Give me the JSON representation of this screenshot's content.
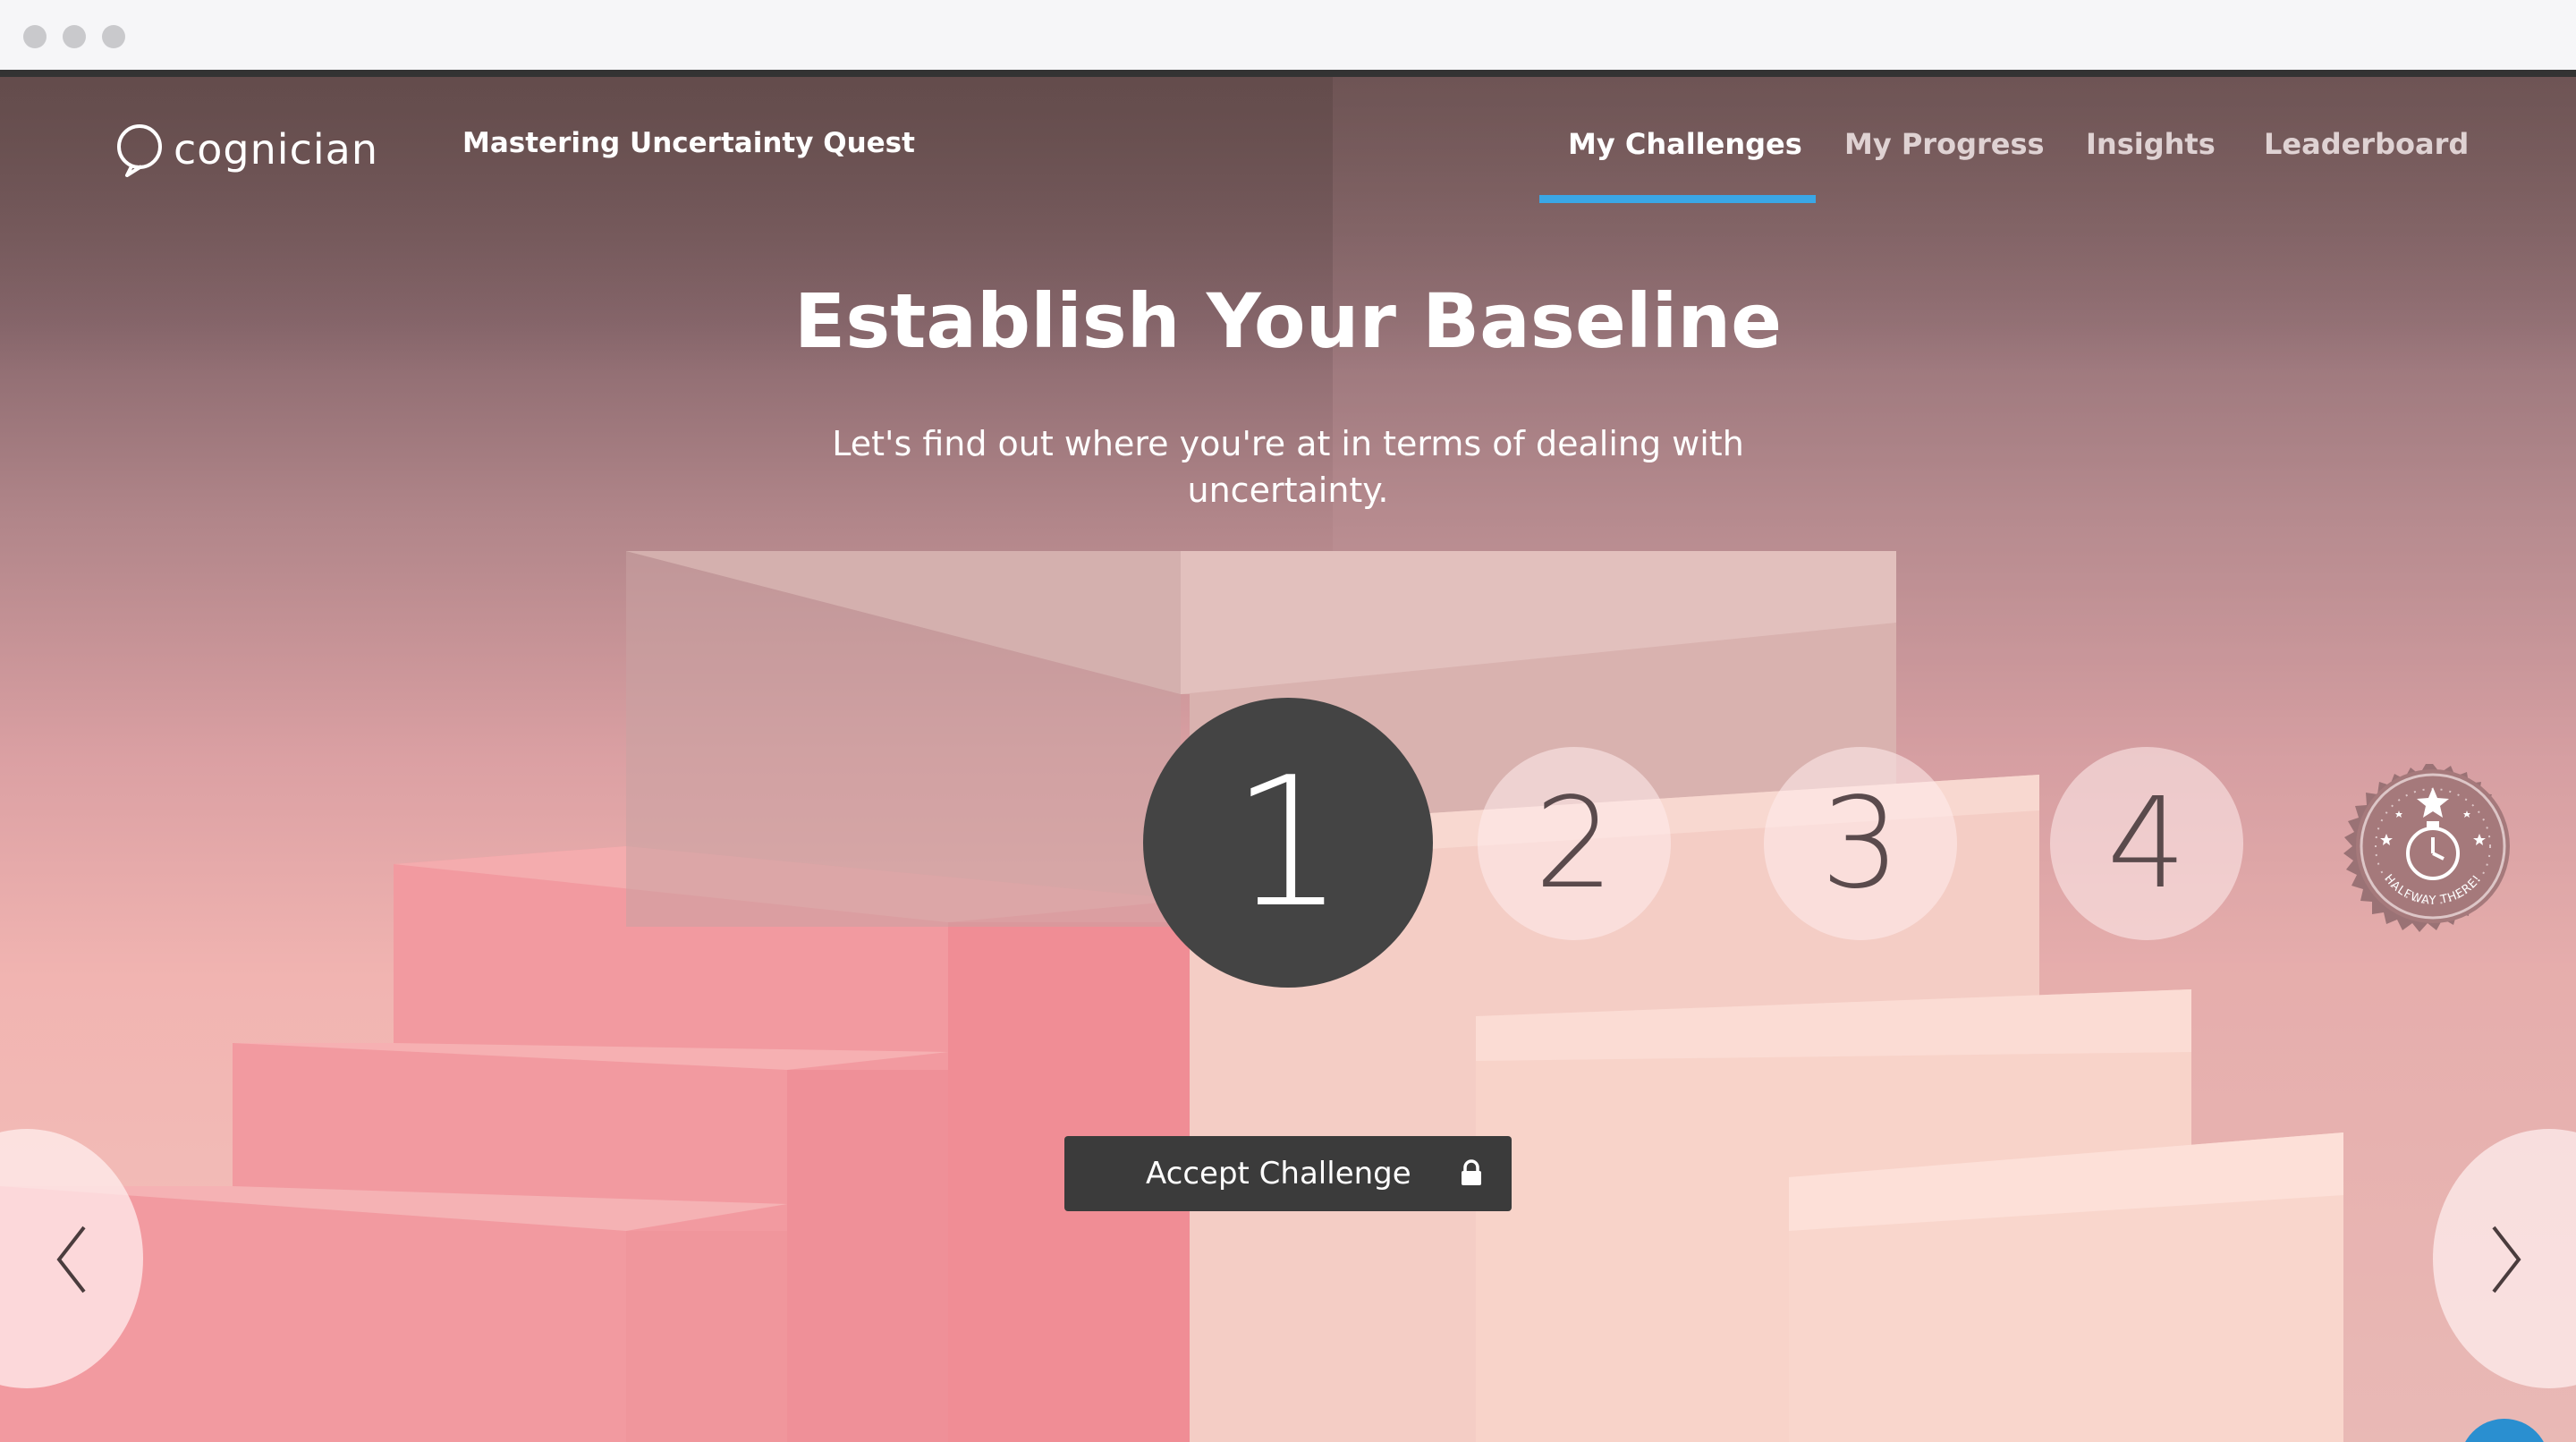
{
  "brand": {
    "logo_text": "cognician",
    "quest_title": "Mastering Uncertainty Quest"
  },
  "nav": {
    "items": [
      {
        "label": "My Challenges",
        "active": true
      },
      {
        "label": "My Progress",
        "active": false
      },
      {
        "label": "Insights",
        "active": false
      },
      {
        "label": "Leaderboard",
        "active": false
      }
    ],
    "accent_color": "#3aa7e6"
  },
  "hero": {
    "title": "Establish Your Baseline",
    "subtitle": "Let's find out where you're at in terms of dealing with uncertainty."
  },
  "steps": [
    {
      "number": "1",
      "state": "current"
    },
    {
      "number": "2",
      "state": "upcoming"
    },
    {
      "number": "3",
      "state": "upcoming"
    },
    {
      "number": "4",
      "state": "upcoming"
    }
  ],
  "badge": {
    "text": "HALFWAY THERE!",
    "icon": "stopwatch-icon"
  },
  "accept_button": {
    "label": "Accept Challenge",
    "icon": "lock-icon"
  },
  "icons": {
    "prev": "chevron-left-icon",
    "next": "chevron-right-icon",
    "logo": "speech-bubble-icon"
  }
}
